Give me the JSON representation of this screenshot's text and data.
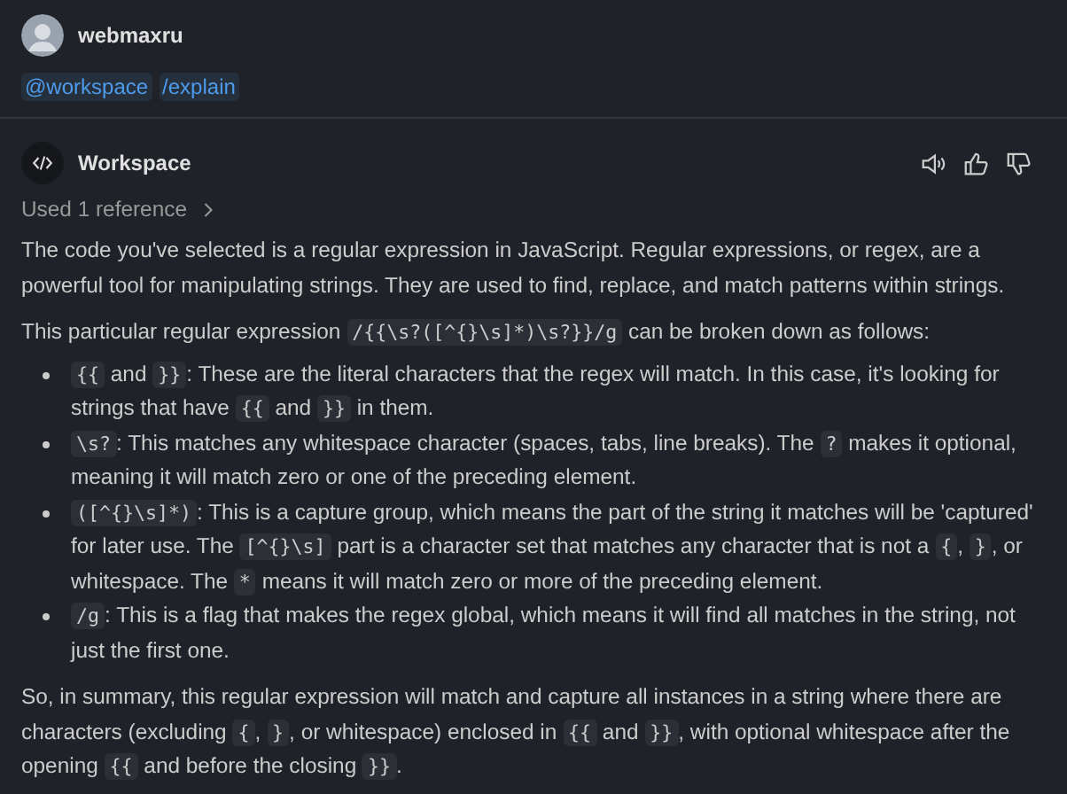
{
  "user": {
    "name": "webmaxru",
    "chips": [
      "@workspace",
      "/explain"
    ]
  },
  "response": {
    "agent": "Workspace",
    "references": "Used 1 reference",
    "intro": [
      {
        "kind": "text",
        "text": "The code you've selected is a regular expression in JavaScript. Regular expressions, or regex, are a powerful tool for manipulating strings. They are used to find, replace, and match patterns within strings."
      }
    ],
    "lead": [
      {
        "kind": "text",
        "text": "This particular regular expression "
      },
      {
        "kind": "code",
        "text": "/{{\\s?([^{}\\s]*)\\s?}}/g"
      },
      {
        "kind": "text",
        "text": " can be broken down as follows:"
      }
    ],
    "bullets": [
      [
        {
          "kind": "code",
          "text": "{{"
        },
        {
          "kind": "text",
          "text": " and "
        },
        {
          "kind": "code",
          "text": "}}"
        },
        {
          "kind": "text",
          "text": ": These are the literal characters that the regex will match. In this case, it's looking for strings that have "
        },
        {
          "kind": "code",
          "text": "{{"
        },
        {
          "kind": "text",
          "text": " and "
        },
        {
          "kind": "code",
          "text": "}}"
        },
        {
          "kind": "text",
          "text": " in them."
        }
      ],
      [
        {
          "kind": "code",
          "text": "\\s?"
        },
        {
          "kind": "text",
          "text": ": This matches any whitespace character (spaces, tabs, line breaks). The "
        },
        {
          "kind": "code",
          "text": "?"
        },
        {
          "kind": "text",
          "text": " makes it optional, meaning it will match zero or one of the preceding element."
        }
      ],
      [
        {
          "kind": "code",
          "text": "([^{}\\s]*)"
        },
        {
          "kind": "text",
          "text": ": This is a capture group, which means the part of the string it matches will be 'captured' for later use. The "
        },
        {
          "kind": "code",
          "text": "[^{}\\s]"
        },
        {
          "kind": "text",
          "text": " part is a character set that matches any character that is not a "
        },
        {
          "kind": "code",
          "text": "{"
        },
        {
          "kind": "text",
          "text": ", "
        },
        {
          "kind": "code",
          "text": "}"
        },
        {
          "kind": "text",
          "text": ", or whitespace. The "
        },
        {
          "kind": "code",
          "text": "*"
        },
        {
          "kind": "text",
          "text": " means it will match zero or more of the preceding element."
        }
      ],
      [
        {
          "kind": "code",
          "text": "/g"
        },
        {
          "kind": "text",
          "text": ": This is a flag that makes the regex global, which means it will find all matches in the string, not just the first one."
        }
      ]
    ],
    "summary": [
      {
        "kind": "text",
        "text": "So, in summary, this regular expression will match and capture all instances in a string where there are characters (excluding "
      },
      {
        "kind": "code",
        "text": "{"
      },
      {
        "kind": "text",
        "text": ", "
      },
      {
        "kind": "code",
        "text": "}"
      },
      {
        "kind": "text",
        "text": ", or whitespace) enclosed in "
      },
      {
        "kind": "code",
        "text": "{{"
      },
      {
        "kind": "text",
        "text": " and "
      },
      {
        "kind": "code",
        "text": "}}"
      },
      {
        "kind": "text",
        "text": ", with optional whitespace after the opening "
      },
      {
        "kind": "code",
        "text": "{{"
      },
      {
        "kind": "text",
        "text": " and before the closing "
      },
      {
        "kind": "code",
        "text": "}}"
      },
      {
        "kind": "text",
        "text": "."
      }
    ]
  }
}
